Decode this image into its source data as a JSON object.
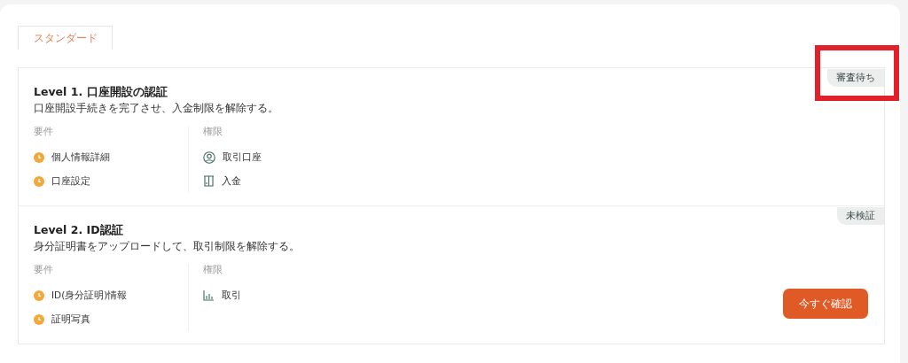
{
  "tabs": [
    {
      "label": "スタンダード",
      "selected": true
    }
  ],
  "levels": [
    {
      "title": "Level 1. 口座開設の認証",
      "description": "口座開設手続きを完了させ、入金制限を解除する。",
      "status": "審査待ち",
      "highlighted": true,
      "requirements_label": "要件",
      "requirements": [
        "個人情報詳細",
        "口座設定"
      ],
      "permissions_label": "権限",
      "permissions": [
        {
          "kind": "account",
          "label": "取引口座"
        },
        {
          "kind": "deposit",
          "label": "入金"
        }
      ]
    },
    {
      "title": "Level 2. ID認証",
      "description": "身分証明書をアップロードして、取引制限を解除する。",
      "status": "未検証",
      "highlighted": false,
      "requirements_label": "要件",
      "requirements": [
        "ID(身分証明)情報",
        "証明写真"
      ],
      "permissions_label": "権限",
      "permissions": [
        {
          "kind": "trade",
          "label": "取引"
        }
      ],
      "action": "今すぐ確認"
    }
  ]
}
